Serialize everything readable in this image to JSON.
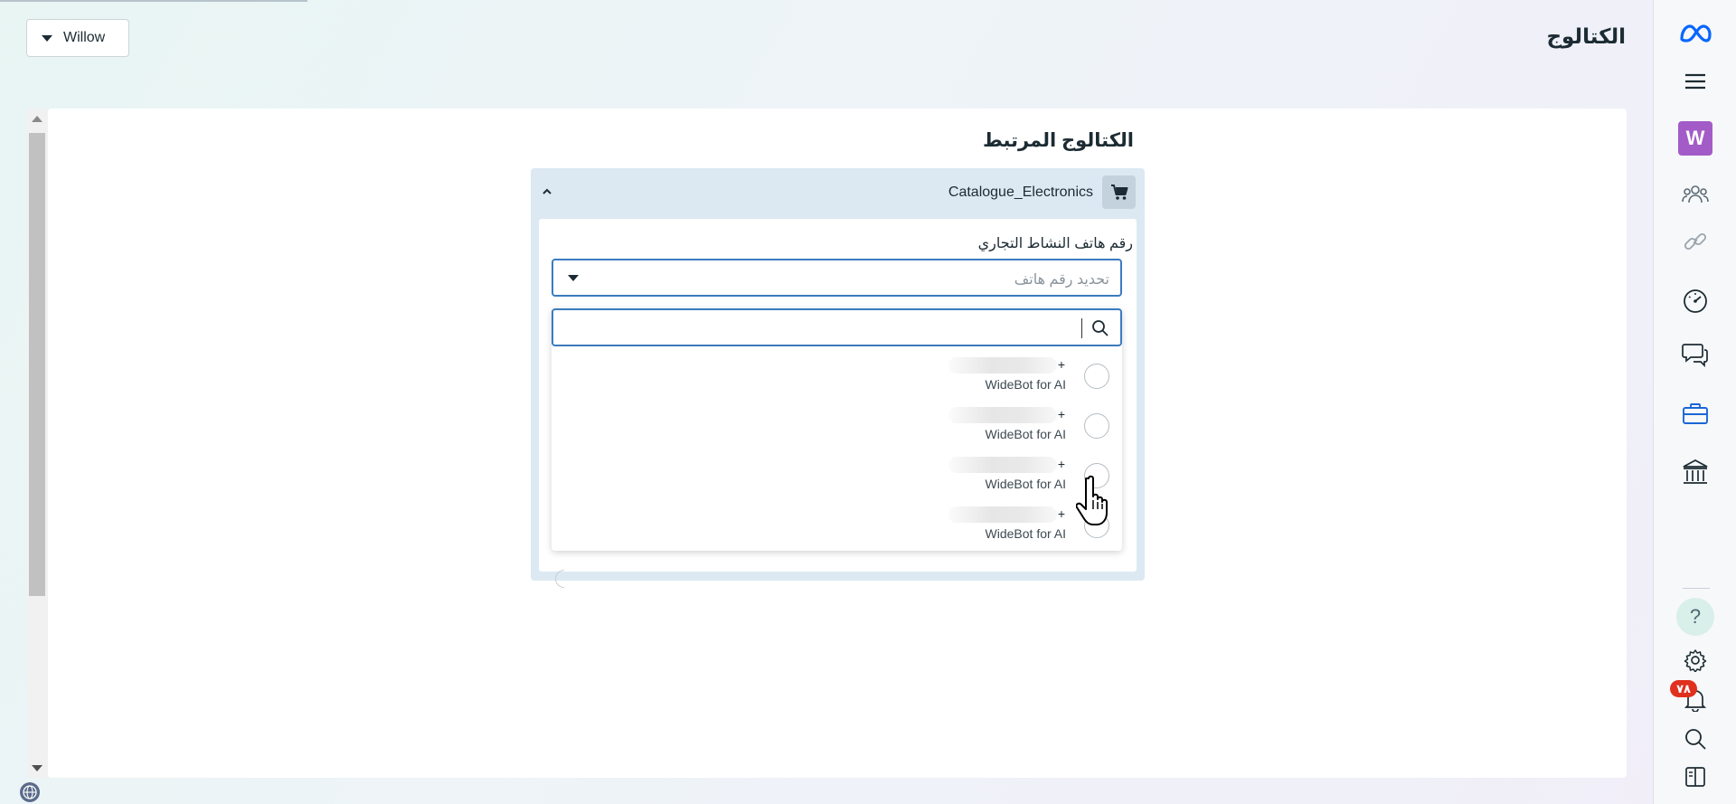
{
  "header": {
    "page_title": "الكتالوج",
    "account_name": "Willow"
  },
  "main": {
    "section_title": "الكتالوج المرتبط",
    "catalog": {
      "name": "Catalogue_Electronics",
      "phone_field_label": "رقم هاتف النشاط التجاري",
      "phone_placeholder": "تحديد رقم هاتف",
      "search_value": "",
      "options": [
        {
          "prefix": "+",
          "business_name": "WideBot for AI"
        },
        {
          "prefix": "+",
          "business_name": "WideBot for AI"
        },
        {
          "prefix": "+",
          "business_name": "WideBot for AI"
        },
        {
          "prefix": "+",
          "business_name": "WideBot for AI"
        }
      ]
    }
  },
  "sidebar": {
    "avatar_letter": "W",
    "notification_count": "٧٨",
    "help_label": "?",
    "icons": [
      "meta-logo-icon",
      "menu-icon",
      "people-icon",
      "link-icon",
      "gauge-icon",
      "chat-icon",
      "briefcase-icon",
      "bank-icon",
      "help-icon",
      "settings-icon",
      "bell-icon",
      "search-icon",
      "panel-toggle-icon"
    ]
  },
  "colors": {
    "accent_blue": "#3b7bbf",
    "avatar_purple": "#a35cc7",
    "badge_red": "#e0301e",
    "catalog_panel_bg": "#dce9f3"
  }
}
